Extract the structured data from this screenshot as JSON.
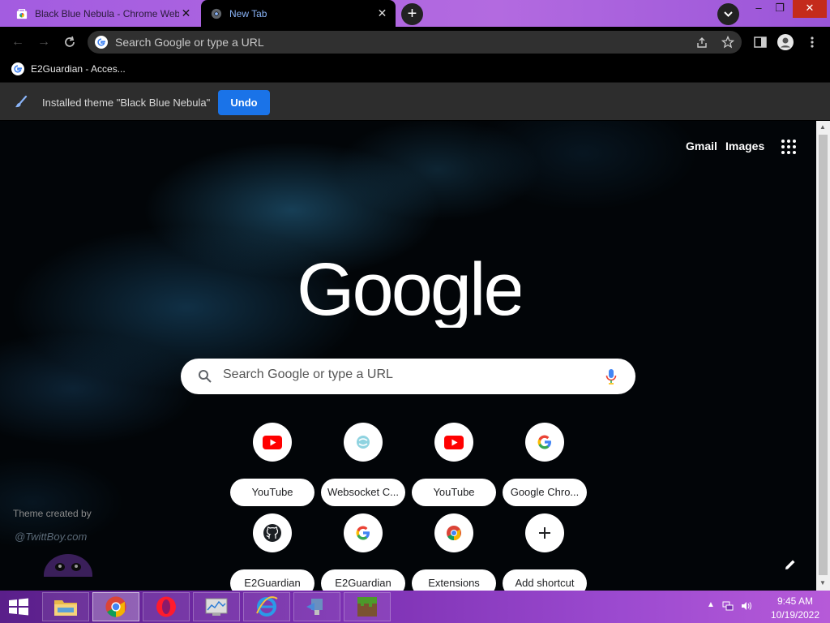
{
  "tabs": [
    {
      "title": "Black Blue Nebula - Chrome Web Store",
      "active": false,
      "close": "✕"
    },
    {
      "title": "New Tab",
      "active": true,
      "close": "✕"
    }
  ],
  "window_controls": {
    "minimize": "–",
    "maximize": "❐",
    "close": "✕"
  },
  "omnibox": {
    "placeholder": "Search Google or type a URL"
  },
  "bookmarks": [
    {
      "label": "E2Guardian - Acces..."
    }
  ],
  "infobar": {
    "message": "Installed theme \"Black Blue Nebula\"",
    "undo_label": "Undo"
  },
  "ntp": {
    "links": {
      "gmail": "Gmail",
      "images": "Images"
    },
    "search": {
      "placeholder": "Search Google or type a URL"
    },
    "shortcuts": [
      {
        "label": "YouTube",
        "icon": "youtube-icon"
      },
      {
        "label": "Websocket C...",
        "icon": "websocket-icon"
      },
      {
        "label": "YouTube",
        "icon": "youtube-icon"
      },
      {
        "label": "Google Chro...",
        "icon": "google-icon"
      },
      {
        "label": "E2Guardian",
        "icon": "github-icon"
      },
      {
        "label": "E2Guardian",
        "icon": "google-icon"
      },
      {
        "label": "Extensions",
        "icon": "chrome-icon"
      },
      {
        "label": "Add shortcut",
        "icon": "plus-icon"
      }
    ],
    "credit": {
      "text": "Theme created by",
      "handle": "@TwittBoy.com"
    }
  },
  "taskbar": {
    "apps": [
      "file-explorer",
      "chrome",
      "opera",
      "task-manager",
      "internet-explorer",
      "remote-desktop",
      "minecraft"
    ],
    "clock": {
      "time": "9:45 AM",
      "date": "10/19/2022"
    }
  },
  "colors": {
    "accent": "#1a73e8",
    "tabstrip": "#a35ce0",
    "taskbar": "#7a2fb0"
  }
}
